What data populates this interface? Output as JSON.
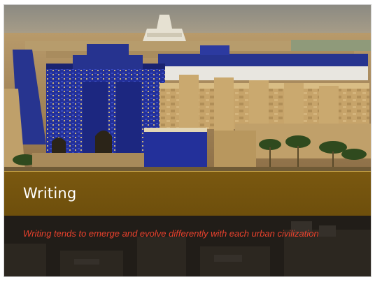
{
  "slide": {
    "title": "Writing",
    "subtitle": "Writing tends to emerge and evolve differently with each urban civilization"
  },
  "colors": {
    "title_band": "#6e4f0c",
    "title_text": "#ffffff",
    "subtitle_text": "#e8412d",
    "gate_blue": "#1e2a8a",
    "wall_tan": "#c9a66b"
  }
}
